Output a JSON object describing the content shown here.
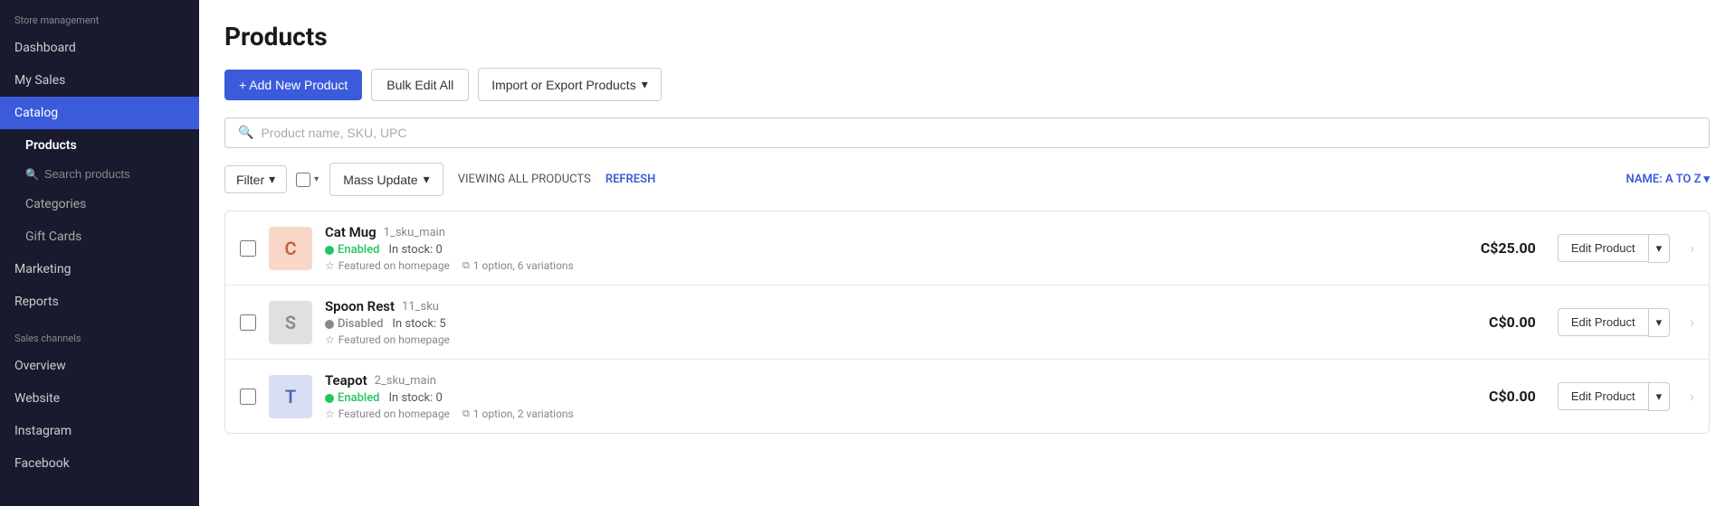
{
  "sidebar": {
    "store_management_label": "Store management",
    "dashboard_label": "Dashboard",
    "my_sales_label": "My Sales",
    "catalog_label": "Catalog",
    "products_label": "Products",
    "categories_label": "Categories",
    "gift_cards_label": "Gift Cards",
    "search_products_placeholder": "Search products",
    "marketing_label": "Marketing",
    "reports_label": "Reports",
    "sales_channels_label": "Sales channels",
    "overview_label": "Overview",
    "website_label": "Website",
    "instagram_label": "Instagram",
    "facebook_label": "Facebook"
  },
  "page": {
    "title": "Products",
    "add_new_label": "+ Add New Product",
    "bulk_edit_label": "Bulk Edit All",
    "import_export_label": "Import or Export Products",
    "filter_label": "Filter",
    "search_placeholder": "Product name, SKU, UPC",
    "mass_update_label": "Mass Update",
    "viewing_label": "VIEWING ALL PRODUCTS",
    "refresh_label": "REFRESH",
    "sort_label": "NAME: A TO Z"
  },
  "products": [
    {
      "initial": "C",
      "avatar_bg": "#f8d7c8",
      "avatar_color": "#c06040",
      "name": "Cat Mug",
      "sku": "1_sku_main",
      "status": "Enabled",
      "status_type": "enabled",
      "stock": "In stock: 0",
      "featured": "Featured on homepage",
      "variations": "1 option, 6 variations",
      "has_variations": true,
      "price": "C$25.00"
    },
    {
      "initial": "S",
      "avatar_bg": "#e0e0e0",
      "avatar_color": "#888",
      "name": "Spoon Rest",
      "sku": "11_sku",
      "status": "Disabled",
      "status_type": "disabled",
      "stock": "In stock: 5",
      "featured": "Featured on homepage",
      "variations": "",
      "has_variations": false,
      "price": "C$0.00"
    },
    {
      "initial": "T",
      "avatar_bg": "#d8dff5",
      "avatar_color": "#5566aa",
      "name": "Teapot",
      "sku": "2_sku_main",
      "status": "Enabled",
      "status_type": "enabled",
      "stock": "In stock: 0",
      "featured": "Featured on homepage",
      "variations": "1 option, 2 variations",
      "has_variations": true,
      "price": "C$0.00"
    }
  ],
  "icons": {
    "chevron_down": "▾",
    "search": "🔍",
    "star": "☆",
    "copy": "⧉",
    "arrow_right": "›",
    "plus": "+"
  }
}
